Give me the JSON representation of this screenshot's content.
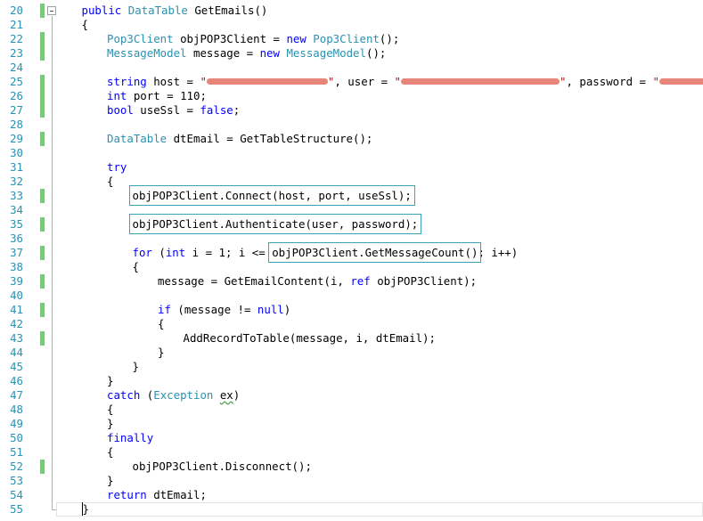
{
  "editor": {
    "lines": [
      {
        "n": "20",
        "changed": true,
        "indent": 1,
        "tokens": [
          [
            "kw",
            "public"
          ],
          [
            "t",
            " "
          ],
          [
            "ty",
            "DataTable"
          ],
          [
            "t",
            " GetEmails()"
          ]
        ]
      },
      {
        "n": "21",
        "changed": false,
        "indent": 1,
        "tokens": [
          [
            "t",
            "{"
          ]
        ]
      },
      {
        "n": "22",
        "changed": true,
        "indent": 2,
        "tokens": [
          [
            "ty",
            "Pop3Client"
          ],
          [
            "t",
            " objPOP3Client = "
          ],
          [
            "kw",
            "new"
          ],
          [
            "t",
            " "
          ],
          [
            "ty",
            "Pop3Client"
          ],
          [
            "t",
            "();"
          ]
        ]
      },
      {
        "n": "23",
        "changed": true,
        "indent": 2,
        "tokens": [
          [
            "ty",
            "MessageModel"
          ],
          [
            "t",
            " message = "
          ],
          [
            "kw",
            "new"
          ],
          [
            "t",
            " "
          ],
          [
            "ty",
            "MessageModel"
          ],
          [
            "t",
            "();"
          ]
        ]
      },
      {
        "n": "24",
        "changed": false,
        "indent": 0,
        "tokens": []
      },
      {
        "n": "25",
        "changed": true,
        "indent": 2,
        "tokens": [
          [
            "kw",
            "string"
          ],
          [
            "t",
            " host = "
          ],
          [
            "st",
            "\""
          ],
          [
            "r",
            "136"
          ],
          [
            "st",
            "\""
          ],
          [
            "t",
            ", user = "
          ],
          [
            "st",
            "\""
          ],
          [
            "r",
            "178"
          ],
          [
            "st",
            "\""
          ],
          [
            "t",
            ", password = "
          ],
          [
            "st",
            "\""
          ],
          [
            "r",
            "58"
          ],
          [
            "st",
            "\""
          ],
          [
            "t",
            ";"
          ]
        ]
      },
      {
        "n": "26",
        "changed": true,
        "indent": 2,
        "tokens": [
          [
            "kw",
            "int"
          ],
          [
            "t",
            " port = 110;"
          ]
        ]
      },
      {
        "n": "27",
        "changed": true,
        "indent": 2,
        "tokens": [
          [
            "kw",
            "bool"
          ],
          [
            "t",
            " useSsl = "
          ],
          [
            "kw",
            "false"
          ],
          [
            "t",
            ";"
          ]
        ]
      },
      {
        "n": "28",
        "changed": false,
        "indent": 0,
        "tokens": []
      },
      {
        "n": "29",
        "changed": true,
        "indent": 2,
        "tokens": [
          [
            "ty",
            "DataTable"
          ],
          [
            "t",
            " dtEmail = GetTableStructure();"
          ]
        ]
      },
      {
        "n": "30",
        "changed": false,
        "indent": 0,
        "tokens": []
      },
      {
        "n": "31",
        "changed": false,
        "indent": 2,
        "tokens": [
          [
            "kw",
            "try"
          ]
        ]
      },
      {
        "n": "32",
        "changed": false,
        "indent": 2,
        "tokens": [
          [
            "t",
            "{"
          ]
        ]
      },
      {
        "n": "33",
        "changed": true,
        "indent": 3,
        "tokens": [
          [
            "b",
            "objPOP3Client.Connect(host, port, useSsl);"
          ]
        ]
      },
      {
        "n": "34",
        "changed": false,
        "indent": 0,
        "tokens": []
      },
      {
        "n": "35",
        "changed": true,
        "indent": 3,
        "tokens": [
          [
            "b",
            "objPOP3Client.Authenticate(user, password);"
          ]
        ]
      },
      {
        "n": "36",
        "changed": false,
        "indent": 0,
        "tokens": []
      },
      {
        "n": "37",
        "changed": true,
        "indent": 3,
        "tokens": [
          [
            "kw",
            "for"
          ],
          [
            "t",
            " ("
          ],
          [
            "kw",
            "int"
          ],
          [
            "t",
            " i = 1; i <= "
          ],
          [
            "b",
            "objPOP3Client.GetMessageCount()"
          ],
          [
            "t",
            "; i++)"
          ]
        ]
      },
      {
        "n": "38",
        "changed": false,
        "indent": 3,
        "tokens": [
          [
            "t",
            "{"
          ]
        ]
      },
      {
        "n": "39",
        "changed": true,
        "indent": 4,
        "tokens": [
          [
            "t",
            "message = GetEmailContent(i, "
          ],
          [
            "kw",
            "ref"
          ],
          [
            "t",
            " objPOP3Client);"
          ]
        ]
      },
      {
        "n": "40",
        "changed": false,
        "indent": 0,
        "tokens": []
      },
      {
        "n": "41",
        "changed": true,
        "indent": 4,
        "tokens": [
          [
            "kw",
            "if"
          ],
          [
            "t",
            " (message != "
          ],
          [
            "kw",
            "null"
          ],
          [
            "t",
            ")"
          ]
        ]
      },
      {
        "n": "42",
        "changed": false,
        "indent": 4,
        "tokens": [
          [
            "t",
            "{"
          ]
        ]
      },
      {
        "n": "43",
        "changed": true,
        "indent": 5,
        "tokens": [
          [
            "t",
            "AddRecordToTable(message, i, dtEmail);"
          ]
        ]
      },
      {
        "n": "44",
        "changed": false,
        "indent": 4,
        "tokens": [
          [
            "t",
            "}"
          ]
        ]
      },
      {
        "n": "45",
        "changed": false,
        "indent": 3,
        "tokens": [
          [
            "t",
            "}"
          ]
        ]
      },
      {
        "n": "46",
        "changed": false,
        "indent": 2,
        "tokens": [
          [
            "t",
            "}"
          ]
        ]
      },
      {
        "n": "47",
        "changed": false,
        "indent": 2,
        "tokens": [
          [
            "kw",
            "catch"
          ],
          [
            "t",
            " ("
          ],
          [
            "ty",
            "Exception"
          ],
          [
            "t",
            " "
          ],
          [
            "sq",
            "ex"
          ],
          [
            "t",
            ")"
          ]
        ]
      },
      {
        "n": "48",
        "changed": false,
        "indent": 2,
        "tokens": [
          [
            "t",
            "{"
          ]
        ]
      },
      {
        "n": "49",
        "changed": false,
        "indent": 2,
        "tokens": [
          [
            "t",
            "}"
          ]
        ]
      },
      {
        "n": "50",
        "changed": false,
        "indent": 2,
        "tokens": [
          [
            "kw",
            "finally"
          ]
        ]
      },
      {
        "n": "51",
        "changed": false,
        "indent": 2,
        "tokens": [
          [
            "t",
            "{"
          ]
        ]
      },
      {
        "n": "52",
        "changed": true,
        "indent": 3,
        "tokens": [
          [
            "t",
            "objPOP3Client.Disconnect();"
          ]
        ]
      },
      {
        "n": "53",
        "changed": false,
        "indent": 2,
        "tokens": [
          [
            "t",
            "}"
          ]
        ]
      },
      {
        "n": "54",
        "changed": false,
        "indent": 2,
        "tokens": [
          [
            "kw",
            "return"
          ],
          [
            "t",
            " dtEmail;"
          ]
        ]
      },
      {
        "n": "55",
        "changed": false,
        "indent": 1,
        "tokens": [
          [
            "c",
            "}"
          ]
        ]
      }
    ]
  },
  "colors": {
    "keyword": "#0000ff",
    "type": "#2b91af",
    "string": "#a31515",
    "line_number": "#2b91af",
    "change_marker": "#6cd36c",
    "highlight_box": "#3ba2b8"
  }
}
